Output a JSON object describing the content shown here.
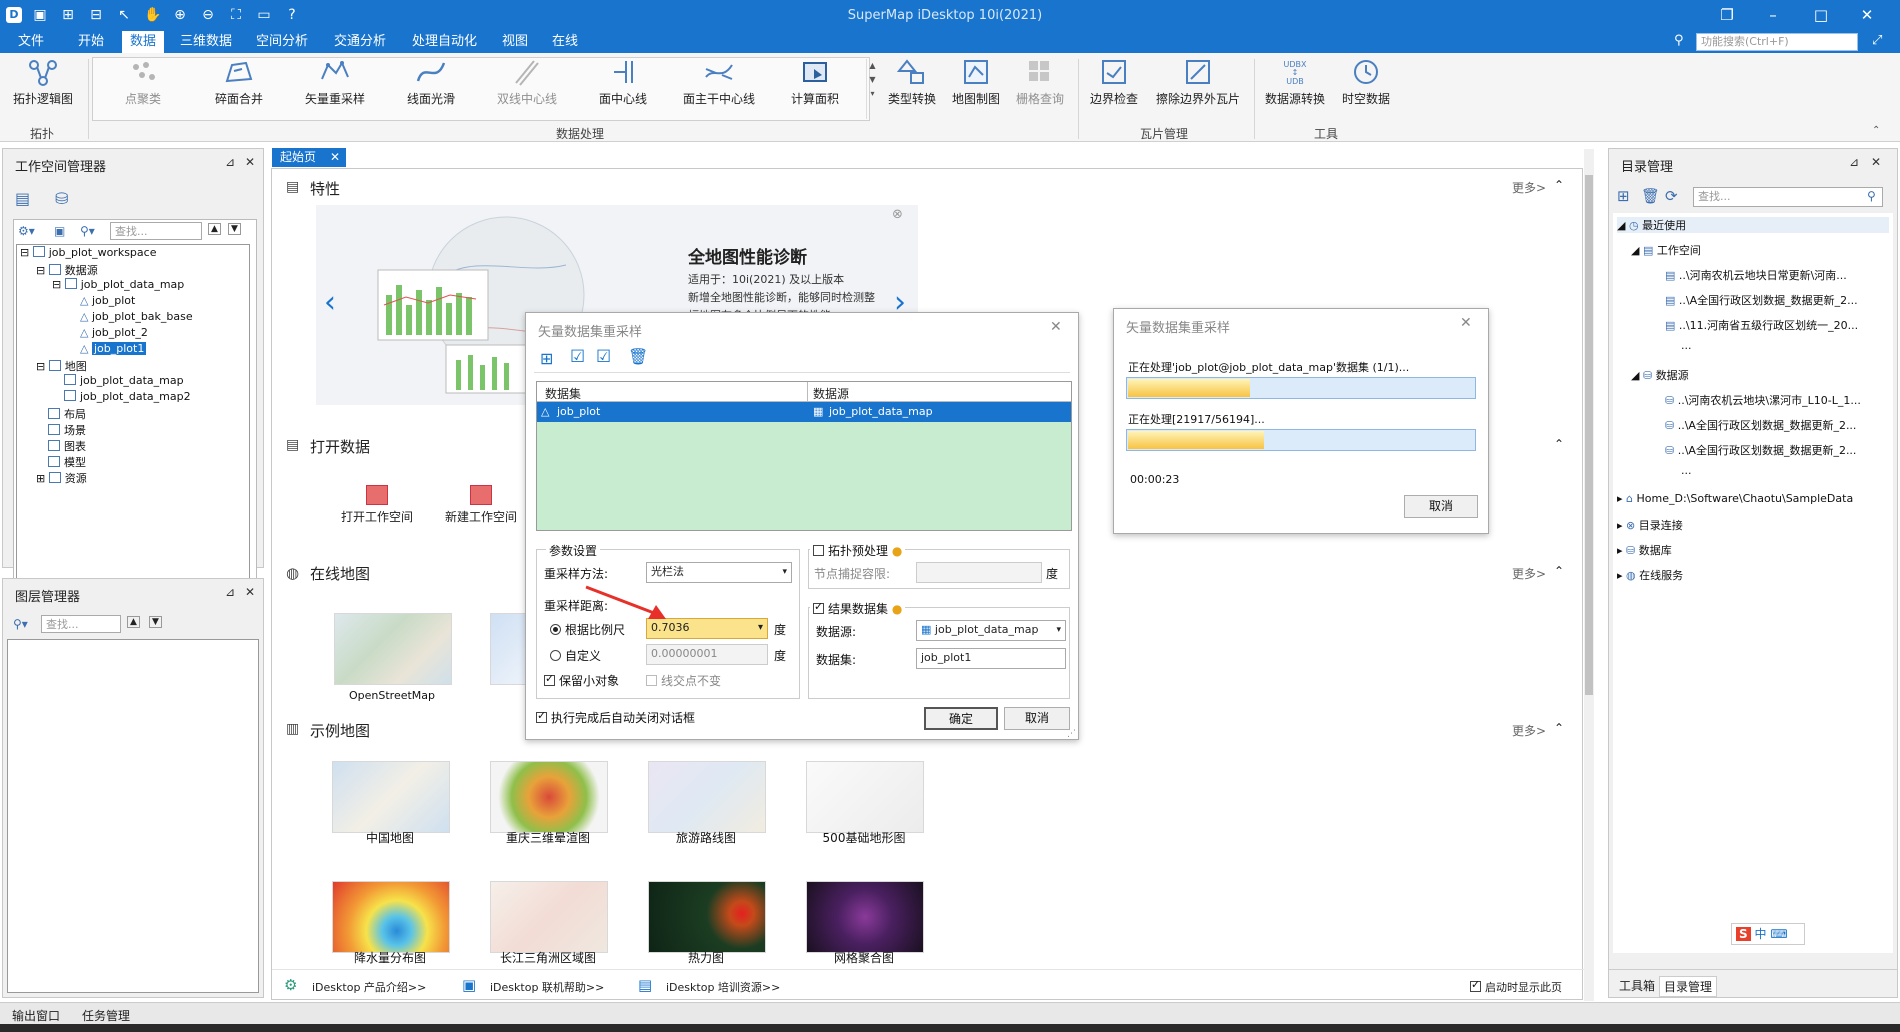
{
  "app": {
    "title": "SuperMap iDesktop 10i(2021)"
  },
  "menu": [
    "文件",
    "开始",
    "数据",
    "三维数据",
    "空间分析",
    "交通分析",
    "处理自动化",
    "视图",
    "在线"
  ],
  "menu_active": "数据",
  "search_placeholder": "功能搜索(Ctrl+F)",
  "ribbon": {
    "topology": {
      "button": "拓扑逻辑图",
      "group": "拓扑"
    },
    "processing": {
      "buttons": [
        "点聚类",
        "碎面合并",
        "矢量重采样",
        "线面光滑",
        "双线中心线",
        "面中心线",
        "面主干中心线",
        "计算面积"
      ],
      "group": "数据处理"
    },
    "extra_buttons": [
      "类型转换",
      "地图制图",
      "栅格查询"
    ],
    "tiles": {
      "buttons": [
        "边界检查",
        "擦除边界外瓦片"
      ],
      "group": "瓦片管理"
    },
    "tools": {
      "buttons": [
        "数据源转换",
        "时空数据"
      ],
      "group": "工具",
      "udb_text": "UDBX\nUDB"
    }
  },
  "workspace_panel": {
    "title": "工作空间管理器",
    "search_placeholder": "查找...",
    "tree": {
      "root": "job_plot_workspace",
      "datasources": "数据源",
      "datasource": "job_plot_data_map",
      "datasets": [
        "job_plot",
        "job_plot_bak_base",
        "job_plot_2",
        "job_plot1"
      ],
      "maps": "地图",
      "map_items": [
        "job_plot_data_map",
        "job_plot_data_map2"
      ],
      "others": [
        "布局",
        "场景",
        "图表",
        "模型",
        "资源"
      ]
    }
  },
  "layer_panel": {
    "title": "图层管理器",
    "search_placeholder": "查找..."
  },
  "start_tab": {
    "label": "起始页"
  },
  "startpage": {
    "features_title": "特性",
    "more": "更多>",
    "banner": {
      "title": "全地图性能诊断",
      "line1": "适用于：10i(2021) 及以上版本",
      "line2": "新增全地图性能诊断，能够同时检测整",
      "line3": "幅地图在多个比例尺下的性能"
    },
    "open_data_title": "打开数据",
    "open_buttons": [
      "打开工作空间",
      "新建工作空间"
    ],
    "online_title": "在线地图",
    "online_maps": [
      "OpenStreetMap"
    ],
    "samples_title": "示例地图",
    "samples": [
      "中国地图",
      "重庆三维晕渲图",
      "旅游路线图",
      "500基础地形图",
      "降水量分布图",
      "长江三角洲区域图",
      "热力图",
      "网格聚合图"
    ],
    "bottom_links": [
      "iDesktop 产品介绍>>",
      "iDesktop 联机帮助>>",
      "iDesktop 培训资源>>"
    ],
    "show_on_start": "启动时显示此页"
  },
  "resample_dialog": {
    "title": "矢量数据集重采样",
    "col_dataset": "数据集",
    "col_datasource": "数据源",
    "row_dataset": "job_plot",
    "row_datasource": "job_plot_data_map",
    "params_title": "参数设置",
    "method_label": "重采样方法:",
    "method_value": "光栏法",
    "distance_label": "重采样距离:",
    "by_scale_label": "根据比例尺",
    "by_scale_value": "0.7036",
    "unit": "度",
    "custom_label": "自定义",
    "custom_value": "0.00000001",
    "keep_small_label": "保留小对象",
    "keep_intersection_label": "线交点不变",
    "topo_pre_label": "拓扑预处理",
    "snap_label": "节点捕捉容限:",
    "result_label": "结果数据集",
    "result_datasource_label": "数据源:",
    "result_datasource_value": "job_plot_data_map",
    "result_dataset_label": "数据集:",
    "result_dataset_value": "job_plot1",
    "auto_close_label": "执行完成后自动关闭对话框",
    "ok": "确定",
    "cancel": "取消"
  },
  "progress_dialog": {
    "title": "矢量数据集重采样",
    "task1": "正在处理'job_plot@job_plot_data_map'数据集 (1/1)...",
    "progress1": 0.35,
    "task2": "正在处理[21917/56194]...",
    "progress2": 0.39,
    "elapsed": "00:00:23",
    "cancel": "取消"
  },
  "catalog_panel": {
    "title": "目录管理",
    "search_placeholder": "查找...",
    "recent": "最近使用",
    "workspace": "工作空间",
    "recent_workspaces": [
      "..\\河南农机云地块日常更新\\河南...",
      "..\\A全国行政区划数据_数据更新_2...",
      "..\\11.河南省五级行政区划统一_20..."
    ],
    "ellipsis": "...",
    "datasources": "数据源",
    "recent_datasources": [
      "..\\河南农机云地块\\漯河市_L10-L_1...",
      "..\\A全国行政区划数据_数据更新_2...",
      "..\\A全国行政区划数据_数据更新_2..."
    ],
    "home": "Home_D:\\Software\\Chaotu\\SampleData",
    "catalog_connect": "目录连接",
    "database": "数据库",
    "online": "在线服务",
    "tabs": [
      "工具箱",
      "目录管理"
    ]
  },
  "status": {
    "output": "输出窗口",
    "tasks": "任务管理"
  },
  "colors": {
    "accent": "#1874cd",
    "dataset_area": "#c7ecd0",
    "selection": "#1874cd"
  }
}
